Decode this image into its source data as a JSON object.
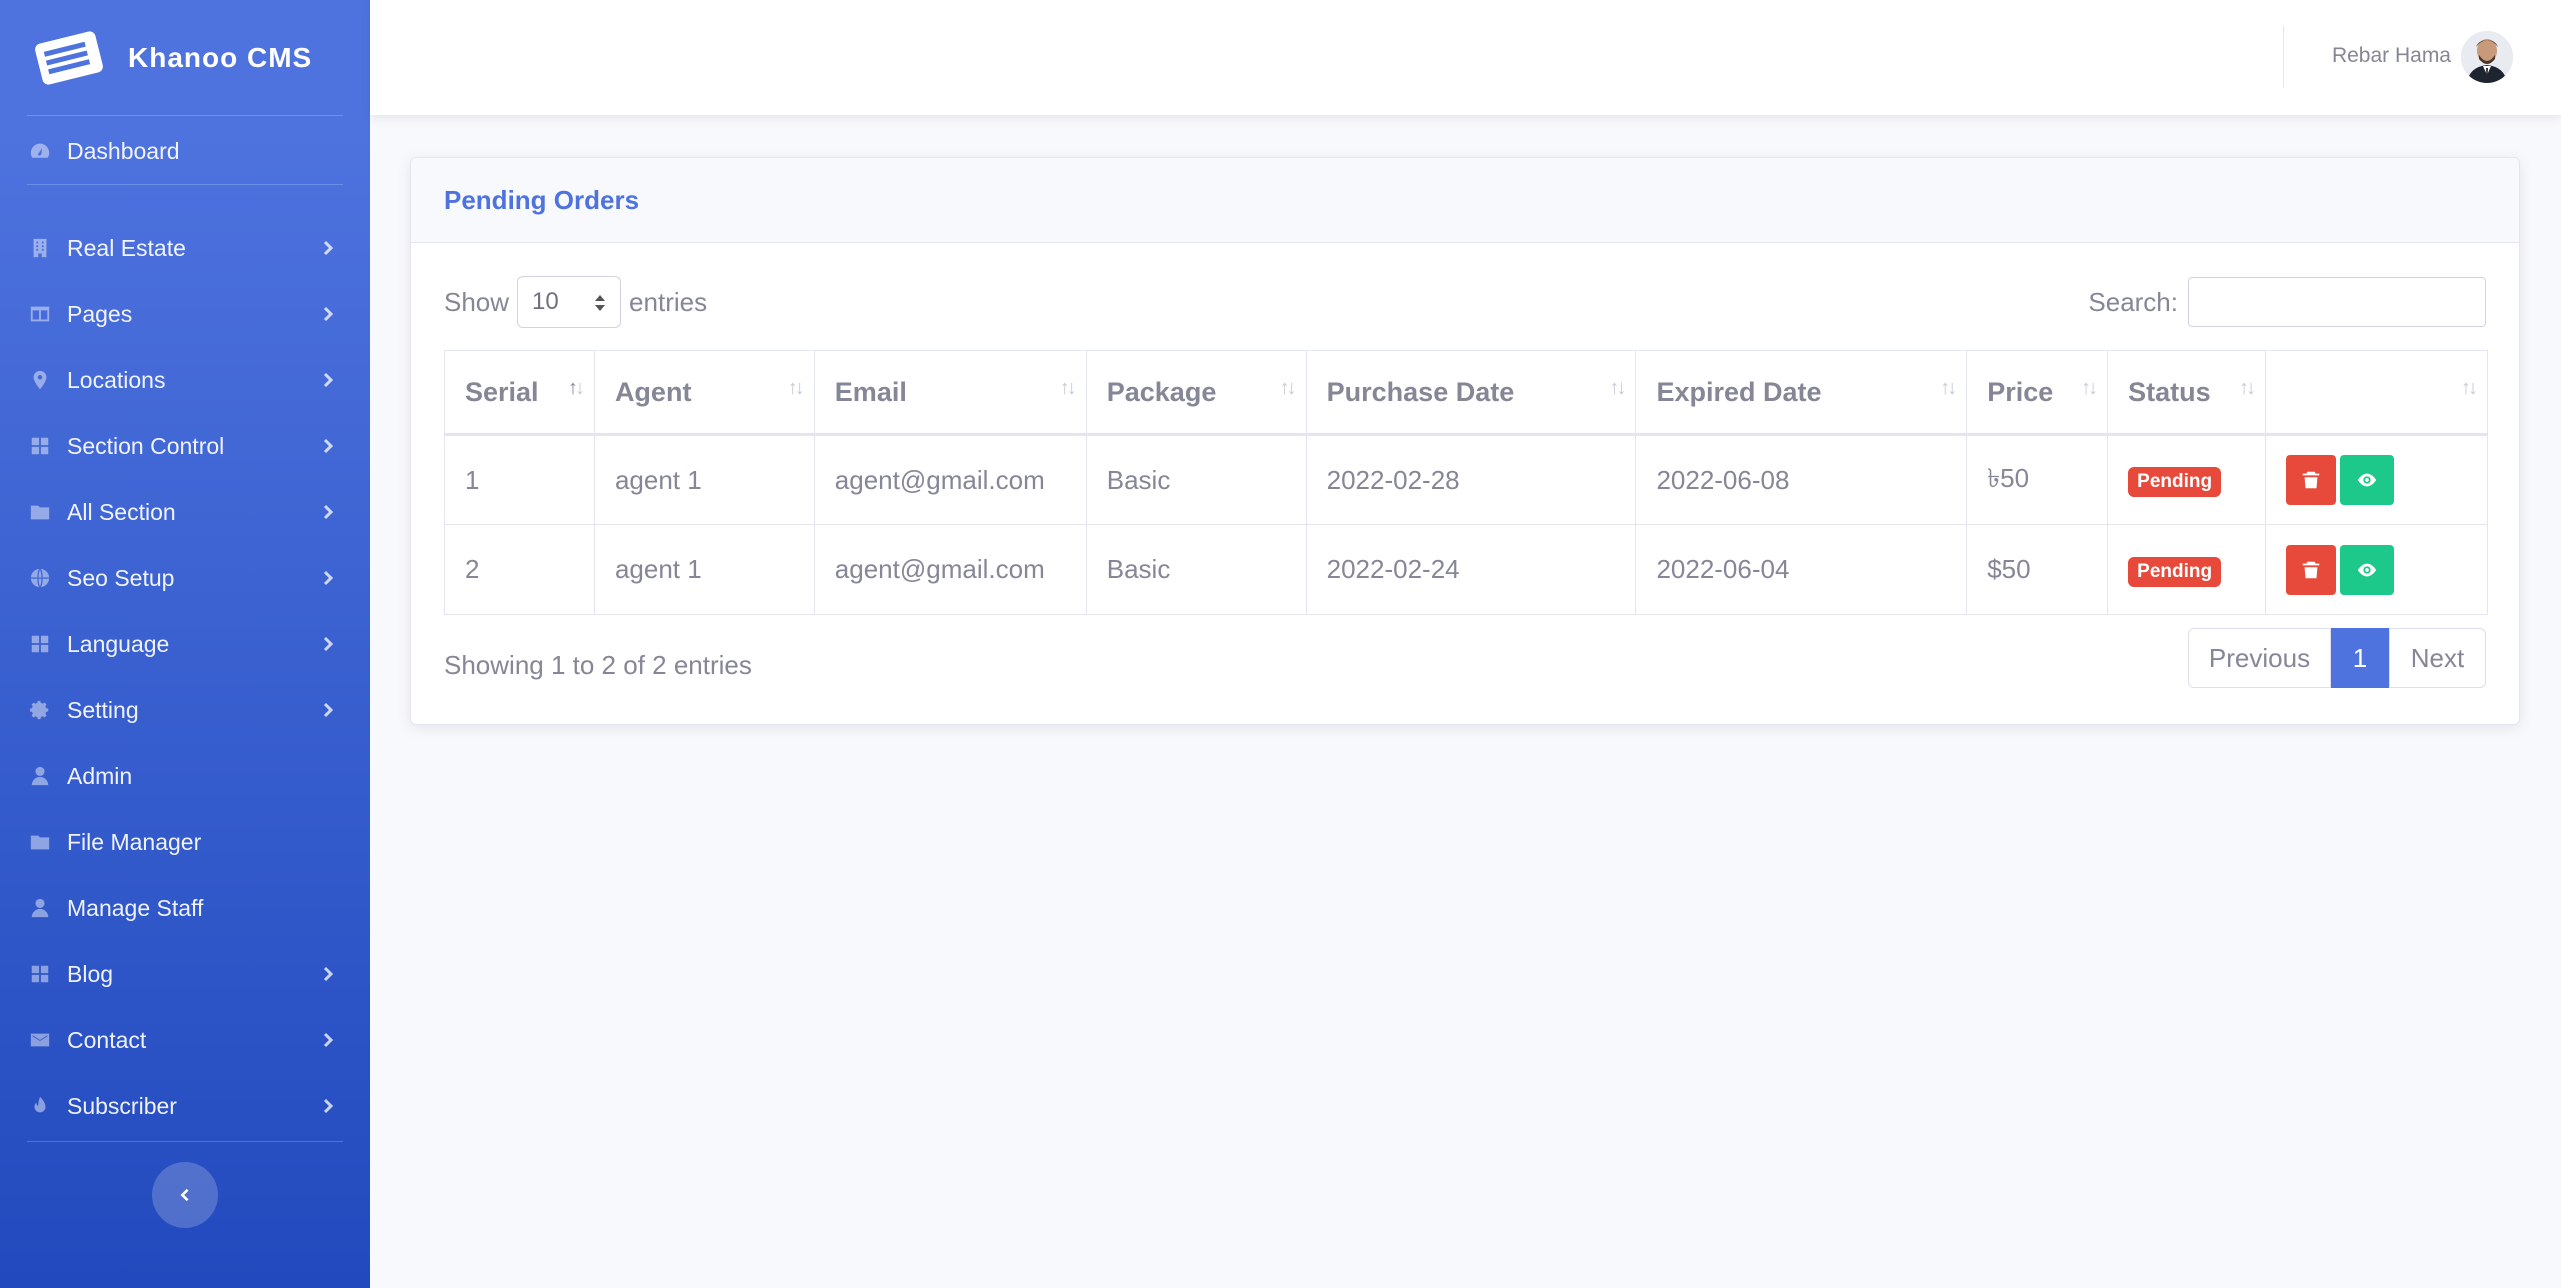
{
  "brand": {
    "name": "Khanoo CMS"
  },
  "sidebar": {
    "dashboard": "Dashboard",
    "items": [
      {
        "label": "Real Estate",
        "icon": "building-icon",
        "chevron": true
      },
      {
        "label": "Pages",
        "icon": "columns-icon",
        "chevron": true
      },
      {
        "label": "Locations",
        "icon": "map-marker-icon",
        "chevron": true
      },
      {
        "label": "Section Control",
        "icon": "grid-icon",
        "chevron": true
      },
      {
        "label": "All Section",
        "icon": "folder-icon",
        "chevron": true
      },
      {
        "label": "Seo Setup",
        "icon": "globe-icon",
        "chevron": true
      },
      {
        "label": "Language",
        "icon": "grid-icon",
        "chevron": true
      },
      {
        "label": "Setting",
        "icon": "gear-icon",
        "chevron": true
      },
      {
        "label": "Admin",
        "icon": "user-icon",
        "chevron": false
      },
      {
        "label": "File Manager",
        "icon": "folder-icon",
        "chevron": false
      },
      {
        "label": "Manage Staff",
        "icon": "user-icon",
        "chevron": false
      },
      {
        "label": "Blog",
        "icon": "grid-icon",
        "chevron": true
      },
      {
        "label": "Contact",
        "icon": "envelope-icon",
        "chevron": true
      },
      {
        "label": "Subscriber",
        "icon": "fire-icon",
        "chevron": true
      }
    ]
  },
  "topbar": {
    "user_name": "Rebar Hama"
  },
  "card": {
    "title": "Pending Orders"
  },
  "table_controls": {
    "show_label": "Show",
    "length_value": "10",
    "entries_label": "entries",
    "search_label": "Search:",
    "search_value": ""
  },
  "table": {
    "columns": [
      "Serial",
      "Agent",
      "Email",
      "Package",
      "Purchase Date",
      "Expired Date",
      "Price",
      "Status",
      ""
    ],
    "rows": [
      {
        "serial": "1",
        "agent": "agent 1",
        "email": "agent@gmail.com",
        "package": "Basic",
        "purchase": "2022-02-28",
        "expired": "2022-06-08",
        "price": "৳50",
        "status": "Pending"
      },
      {
        "serial": "2",
        "agent": "agent 1",
        "email": "agent@gmail.com",
        "package": "Basic",
        "purchase": "2022-02-24",
        "expired": "2022-06-04",
        "price": "$50",
        "status": "Pending"
      }
    ]
  },
  "footer": {
    "info": "Showing 1 to 2 of 2 entries",
    "previous": "Previous",
    "page": "1",
    "next": "Next"
  },
  "colors": {
    "primary": "#4e73df",
    "danger": "#e74a3b",
    "success": "#1cc88a"
  }
}
